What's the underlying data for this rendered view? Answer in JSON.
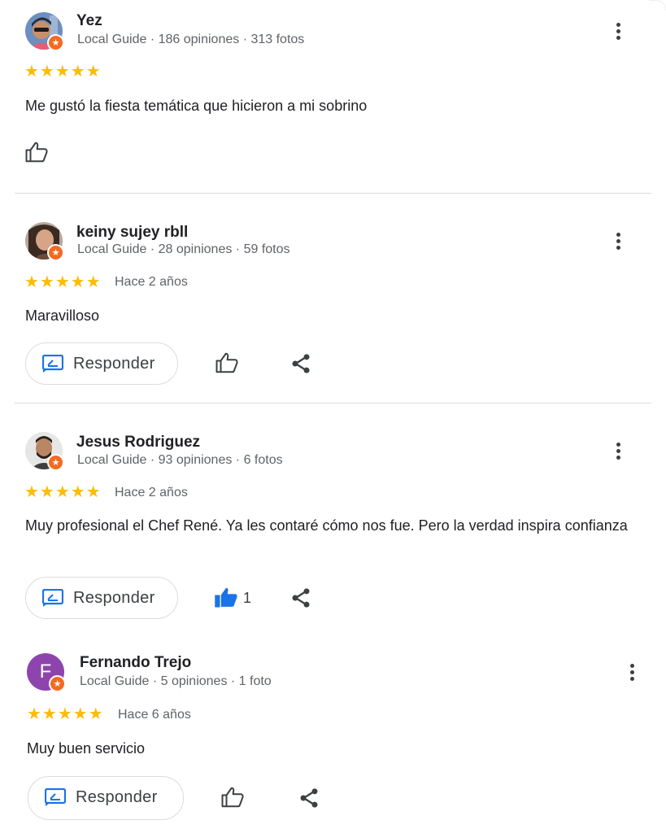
{
  "reviews": [
    {
      "name": "Yez",
      "meta": "Local Guide · 186 opiniones · 313 fotos",
      "stars": "★★★★★",
      "rating": 5,
      "time": "",
      "text": "Me gustó la fiesta temática que hicieron a mi sobrino",
      "avatar_icon": "user-photo-avatar"
    },
    {
      "name": "keiny sujey rbll",
      "meta": "Local Guide · 28 opiniones · 59 fotos",
      "stars": "★★★★★",
      "rating": 5,
      "time": "Hace 2 años",
      "text": "Maravilloso",
      "reply_label": "Responder",
      "avatar_icon": "user-photo-avatar"
    },
    {
      "name": "Jesus Rodriguez",
      "meta": "Local Guide · 93 opiniones · 6 fotos",
      "stars": "★★★★★",
      "rating": 5,
      "time": "Hace 2 años",
      "text": "Muy profesional el Chef René. Ya les contaré cómo nos fue. Pero la verdad inspira confianza",
      "reply_label": "Responder",
      "like_count": "1",
      "avatar_icon": "user-photo-avatar"
    },
    {
      "name": "Fernando Trejo",
      "meta": "Local Guide · 5 opiniones · 1 foto",
      "stars": "★★★★★",
      "rating": 5,
      "time": "Hace 6 años",
      "text": "Muy buen servicio",
      "reply_label": "Responder",
      "avatar_letter": "F",
      "avatar_color": "#8e44ad"
    }
  ],
  "colors": {
    "star": "#fbbc04",
    "accent_blue": "#1a73e8",
    "badge_orange": "#f26b21",
    "text_secondary": "#5f6368"
  },
  "icons": {
    "menu": "more-vert-icon",
    "like": "thumb-up-icon",
    "like_active": "thumb-up-filled-icon",
    "share": "share-icon",
    "reply": "reply-icon",
    "badge": "local-guide-star-icon"
  }
}
